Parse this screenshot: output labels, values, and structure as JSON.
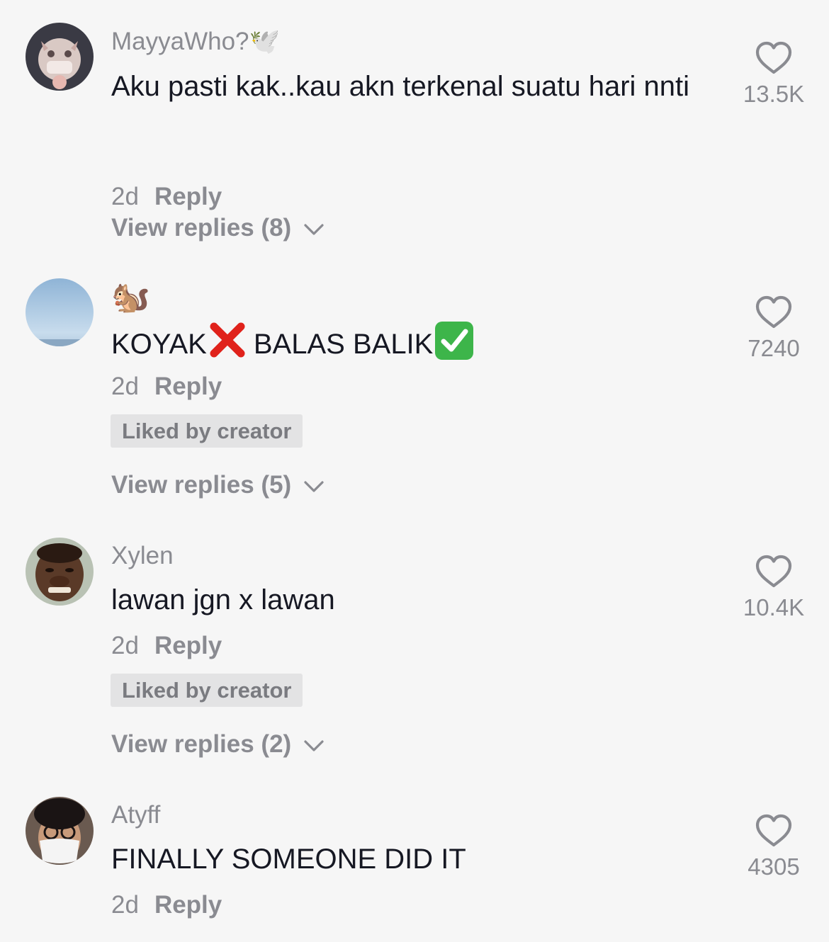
{
  "comments": [
    {
      "username": "MayyaWho?",
      "username_emoji": "🕊️",
      "text": "Aku pasti kak..kau akn terkenal suatu hari nnti",
      "age": "2d",
      "reply_label": "Reply",
      "likes": "13.5K",
      "view_replies": "View replies (8)"
    },
    {
      "username": "",
      "username_emoji": "🐿️",
      "text_part1": "KOYAK",
      "text_emoji1": "❌",
      "text_part2": "BALAS BALIK",
      "text_emoji2": "✅",
      "age": "2d",
      "reply_label": "Reply",
      "badge": "Liked by creator",
      "likes": "7240",
      "view_replies": "View replies (5)"
    },
    {
      "username": "Xylen",
      "text": "lawan jgn x lawan",
      "age": "2d",
      "reply_label": "Reply",
      "badge": "Liked by creator",
      "likes": "10.4K",
      "view_replies": "View replies (2)"
    },
    {
      "username": "Atyff",
      "text": "FINALLY SOMEONE DID IT",
      "age": "2d",
      "reply_label": "Reply",
      "likes": "4305"
    }
  ],
  "icons": {
    "heart": "heart-outline-icon",
    "chevron": "chevron-down-icon"
  },
  "colors": {
    "background": "#f6f6f6",
    "primary_text": "#161823",
    "secondary_text": "#8a8b91",
    "badge_bg": "#e3e3e4"
  }
}
